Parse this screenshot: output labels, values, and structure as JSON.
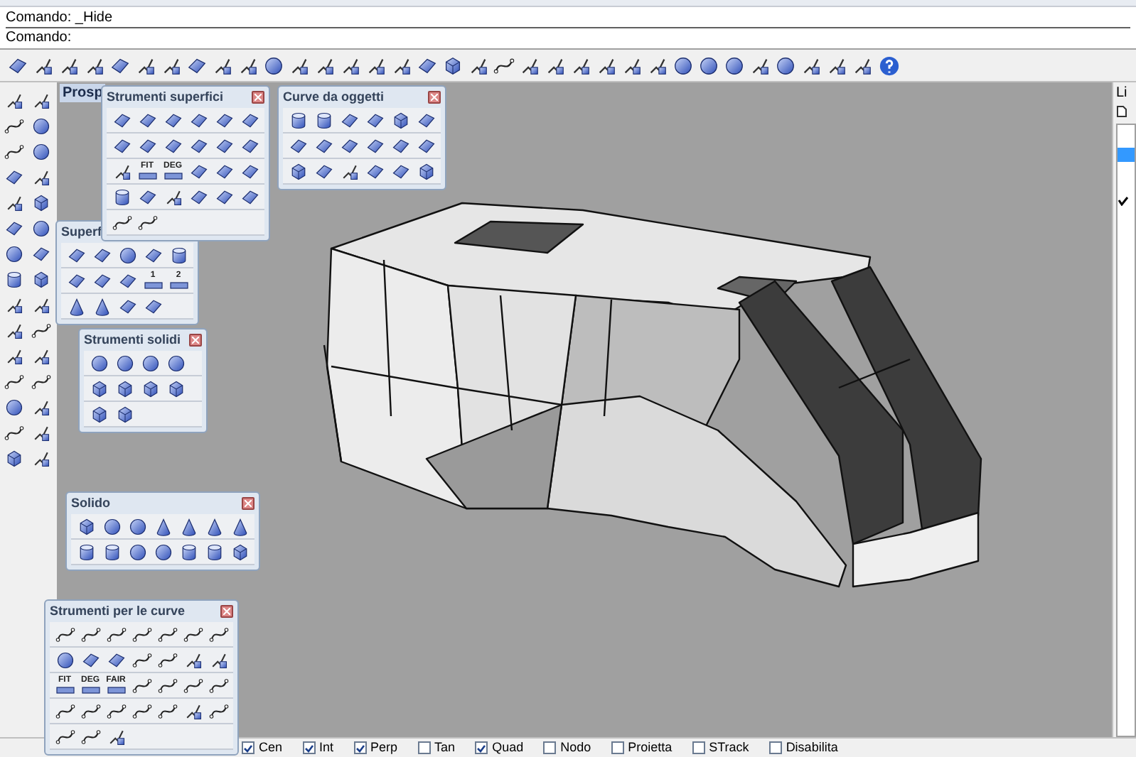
{
  "command_history": "Comando: _Hide",
  "command_prompt": "Comando:",
  "viewport": {
    "title": "Prosp"
  },
  "panels": [
    {
      "title": "Strumenti superfici",
      "icon_labels": [
        "FIT",
        "DEG"
      ]
    },
    {
      "title": "Curve da oggetti"
    },
    {
      "title": "Superf",
      "icon_labels": [
        "1",
        "2"
      ]
    },
    {
      "title": "Strumenti solidi"
    },
    {
      "title": "Solido"
    },
    {
      "title": "Strumenti per le curve",
      "icon_labels": [
        "FIT",
        "DEG",
        "FAIR"
      ]
    }
  ],
  "layers_panel": {
    "title": "Li"
  },
  "osnaps": [
    {
      "label": "Cen",
      "checked": true
    },
    {
      "label": "Int",
      "checked": true
    },
    {
      "label": "Perp",
      "checked": true
    },
    {
      "label": "Tan",
      "checked": false
    },
    {
      "label": "Quad",
      "checked": true
    },
    {
      "label": "Nodo",
      "checked": false
    },
    {
      "label": "Proietta",
      "checked": false
    },
    {
      "label": "STrack",
      "checked": false
    },
    {
      "label": "Disabilita",
      "checked": false
    }
  ]
}
